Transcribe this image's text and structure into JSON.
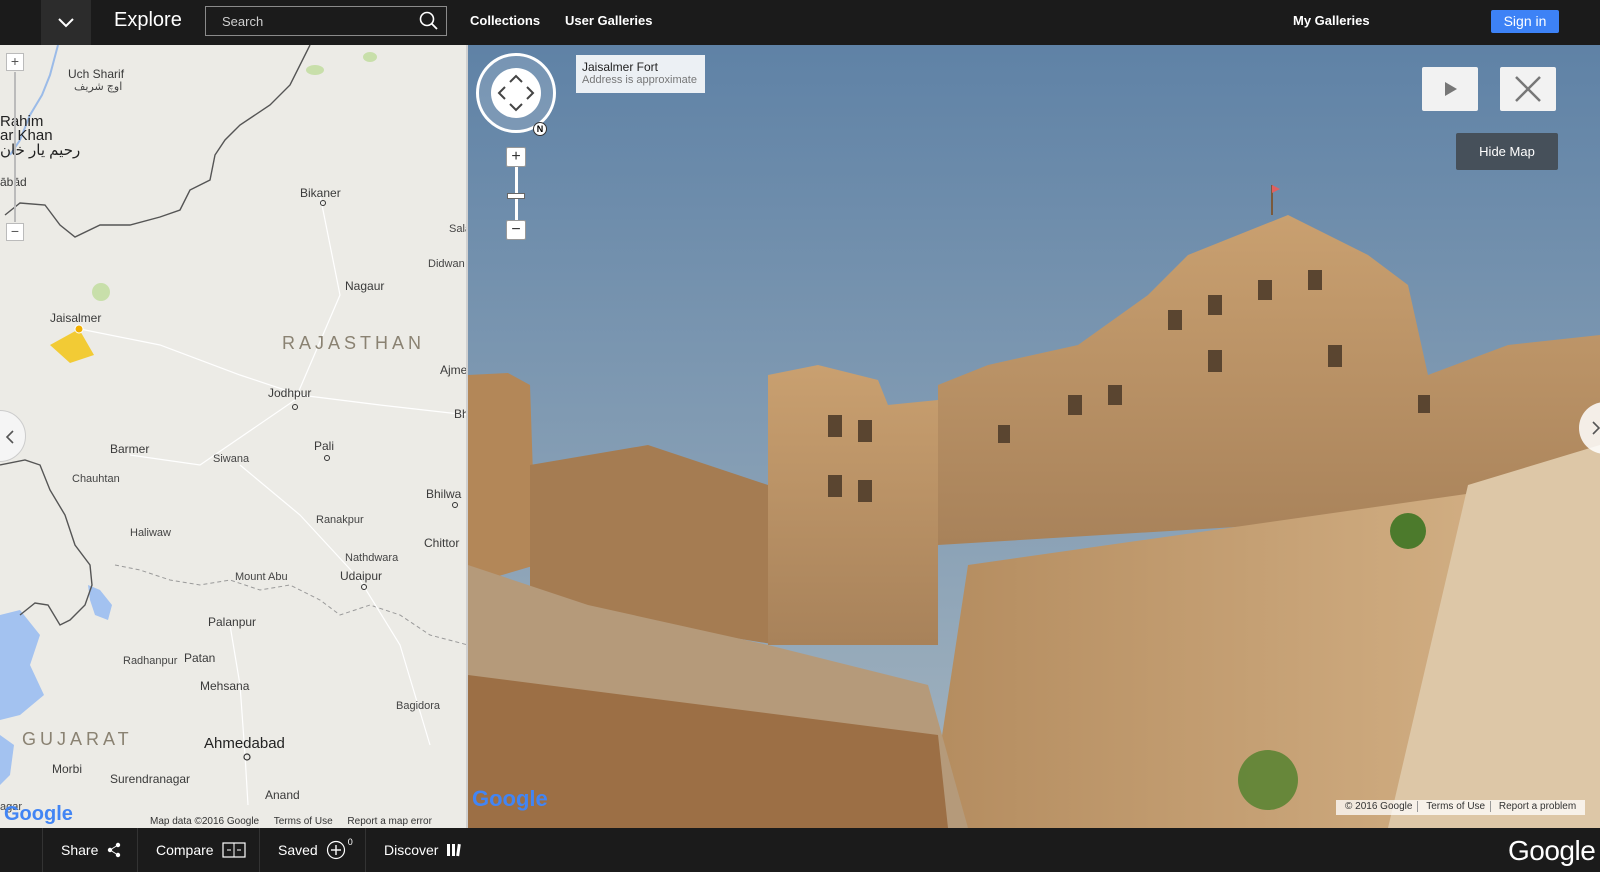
{
  "topbar": {
    "title": "Explore",
    "search_placeholder": "Search",
    "nav": [
      "Collections",
      "User Galleries"
    ],
    "my_galleries": "My Galleries",
    "sign_in": "Sign in"
  },
  "map": {
    "places": {
      "uch_sharif": "Uch Sharif",
      "uch_sharif_urdu": "اوچ شریف",
      "rahim_1": "Rahim",
      "rahim_2": "ar Khan",
      "rahim_urdu": "رحیم یار خان",
      "abad": "ābād",
      "bikaner": "Bikaner",
      "sala": "Sala",
      "didwana": "Didwan",
      "nagaur": "Nagaur",
      "jaisalmer": "Jaisalmer",
      "rajasthan": "RAJASTHAN",
      "ajmer": "Ajme",
      "bh": "Bh",
      "jodhpur": "Jodhpur",
      "pali": "Pali",
      "barmer": "Barmer",
      "siwana": "Siwana",
      "chauhtan": "Chauhtan",
      "bhilwara": "Bhilwa",
      "ranakpur": "Ranakpur",
      "haliwaw": "Haliwaw",
      "chittor": "Chittor",
      "nathdwara": "Nathdwara",
      "mount_abu": "Mount Abu",
      "udaipur": "Udaipur",
      "palanpur": "Palanpur",
      "radhanpur": "Radhanpur",
      "patan": "Patan",
      "mehsana": "Mehsana",
      "bagidora": "Bagidora",
      "gujarat": "GUJARAT",
      "ahmedabad": "Ahmedabad",
      "morbi": "Morbi",
      "surendranagar": "Surendranagar",
      "anand": "Anand",
      "agar": "agar"
    },
    "footer": [
      "Map data ©2016 Google",
      "Terms of Use",
      "Report a map error"
    ],
    "logo": "Google"
  },
  "streetview": {
    "address_title": "Jaisalmer Fort",
    "address_sub": "Address is approximate",
    "compass_n": "N",
    "hide_map": "Hide Map",
    "footer": [
      "© 2016 Google",
      "Terms of Use",
      "Report a problem"
    ],
    "logo": "Google"
  },
  "bottombar": {
    "share": "Share",
    "compare": "Compare",
    "saved": "Saved",
    "saved_count": "0",
    "discover": "Discover",
    "brand": "Google"
  },
  "colors": {
    "topbar_bg": "#1b1b1b",
    "accent": "#3d82f6",
    "sky": "#6d8eab",
    "sandstone": "#c49a66"
  }
}
